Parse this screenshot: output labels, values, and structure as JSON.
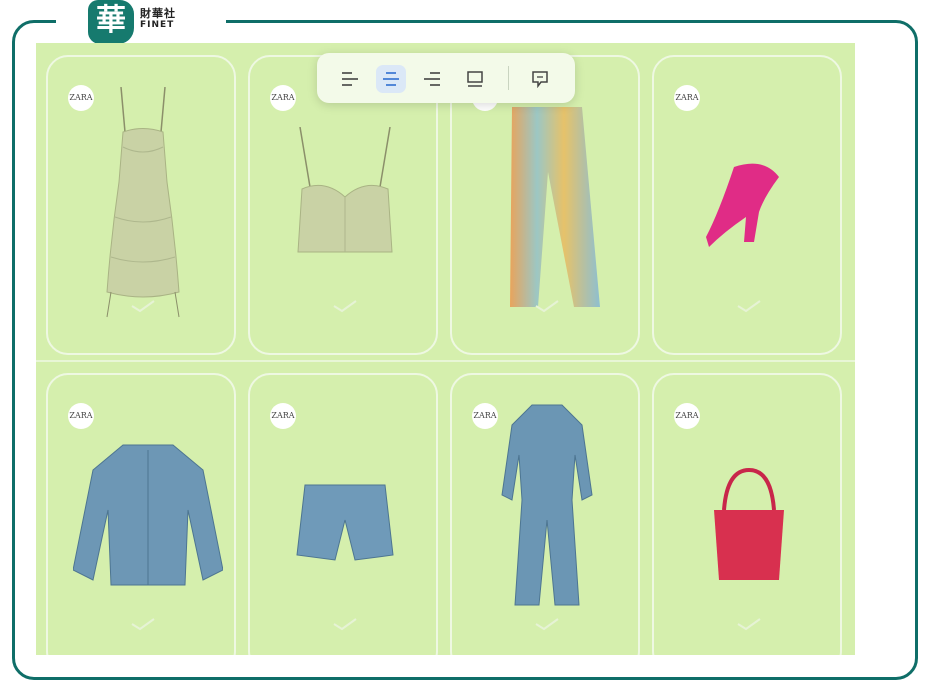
{
  "brand": {
    "seal_char": "華",
    "name_cn": "財華社",
    "name_en": "FINET"
  },
  "toolbar": {
    "buttons": [
      {
        "icon": "align-left-icon",
        "active": false
      },
      {
        "icon": "align-center-icon",
        "active": true
      },
      {
        "icon": "align-right-icon",
        "active": false
      },
      {
        "icon": "display-icon",
        "active": false
      },
      {
        "icon": "comment-icon",
        "active": false
      }
    ]
  },
  "colors": {
    "panel": "#d5efad",
    "frame": "#0f6e68",
    "active_btn": "#dbe8f7"
  },
  "products": [
    {
      "brand_badge": "ZARA",
      "item": "satin mini dress"
    },
    {
      "brand_badge": "ZARA",
      "item": "satin bustier top"
    },
    {
      "brand_badge": "ZARA",
      "item": "gradient jeans"
    },
    {
      "brand_badge": "ZARA",
      "item": "pink platform heel"
    },
    {
      "brand_badge": "ZARA",
      "item": "denim jacket"
    },
    {
      "brand_badge": "ZARA",
      "item": "denim shorts"
    },
    {
      "brand_badge": "ZARA",
      "item": "denim jumpsuit"
    },
    {
      "brand_badge": "ZARA",
      "item": "red woven tote bag"
    }
  ]
}
